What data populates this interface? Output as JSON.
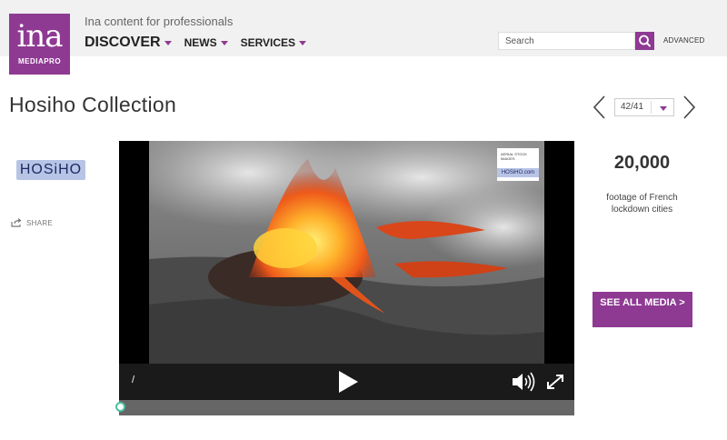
{
  "header": {
    "logo": {
      "word": "ina",
      "sub": "MEDIAPRO"
    },
    "tagline": "Ina content for professionals",
    "nav": [
      {
        "label": "DISCOVER"
      },
      {
        "label": "NEWS"
      },
      {
        "label": "SERVICES"
      }
    ],
    "search": {
      "placeholder": "Search"
    },
    "advanced_label": "ADVANCED"
  },
  "page": {
    "title": "Hosiho Collection",
    "pager": {
      "value": "42/41"
    }
  },
  "left": {
    "partner_logo_text": "HOSiHO",
    "share_label": "SHARE"
  },
  "player": {
    "time_display": "/",
    "progress": 0,
    "watermark": {
      "brand": "HOSiHO.com",
      "caption": "AERIAL STOCK IMAGES"
    }
  },
  "right": {
    "stat_number": "20,000",
    "stat_caption": "footage of French lockdown cities",
    "see_all_label": "SEE ALL MEDIA >"
  },
  "colors": {
    "accent": "#8e3a93",
    "header_bg": "#f1f1f1",
    "player_bg": "#000000"
  },
  "icons": [
    "search-icon",
    "chevron-left-icon",
    "chevron-right-icon",
    "share-icon",
    "play-icon",
    "volume-icon",
    "fullscreen-icon"
  ]
}
